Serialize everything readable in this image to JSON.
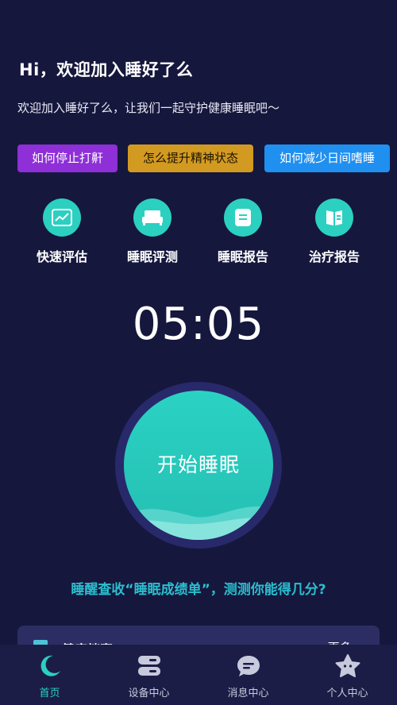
{
  "header": {
    "greeting": "Hi，欢迎加入睡好了么",
    "subtitle": "欢迎加入睡好了么，让我们一起守护健康睡眠吧～"
  },
  "tags": [
    {
      "label": "如何停止打鼾",
      "color": "#8e2fd8"
    },
    {
      "label": "怎么提升精神状态",
      "color": "#d39a22"
    },
    {
      "label": "如何减少日间嗜睡",
      "color": "#1f8ff0"
    }
  ],
  "features": [
    {
      "label": "快速评估",
      "icon": "chart-icon"
    },
    {
      "label": "睡眠评测",
      "icon": "bed-icon"
    },
    {
      "label": "睡眠报告",
      "icon": "report-icon"
    },
    {
      "label": "治疗报告",
      "icon": "book-icon"
    }
  ],
  "clock": {
    "time": "05:05"
  },
  "sleep_button": {
    "label": "开始睡眠"
  },
  "hint": "睡醒查收“睡眠成绩单”，测测你能得几分?",
  "card": {
    "title": "健康档案",
    "more": "更多 >"
  },
  "tabbar": {
    "items": [
      {
        "label": "首页",
        "icon": "moon-icon",
        "active": true
      },
      {
        "label": "设备中心",
        "icon": "device-icon",
        "active": false
      },
      {
        "label": "消息中心",
        "icon": "message-icon",
        "active": false
      },
      {
        "label": "个人中心",
        "icon": "star-icon",
        "active": false
      }
    ]
  },
  "colors": {
    "background": "#16173d",
    "accent": "#2bd0c1",
    "hint": "#2bbfcf"
  }
}
